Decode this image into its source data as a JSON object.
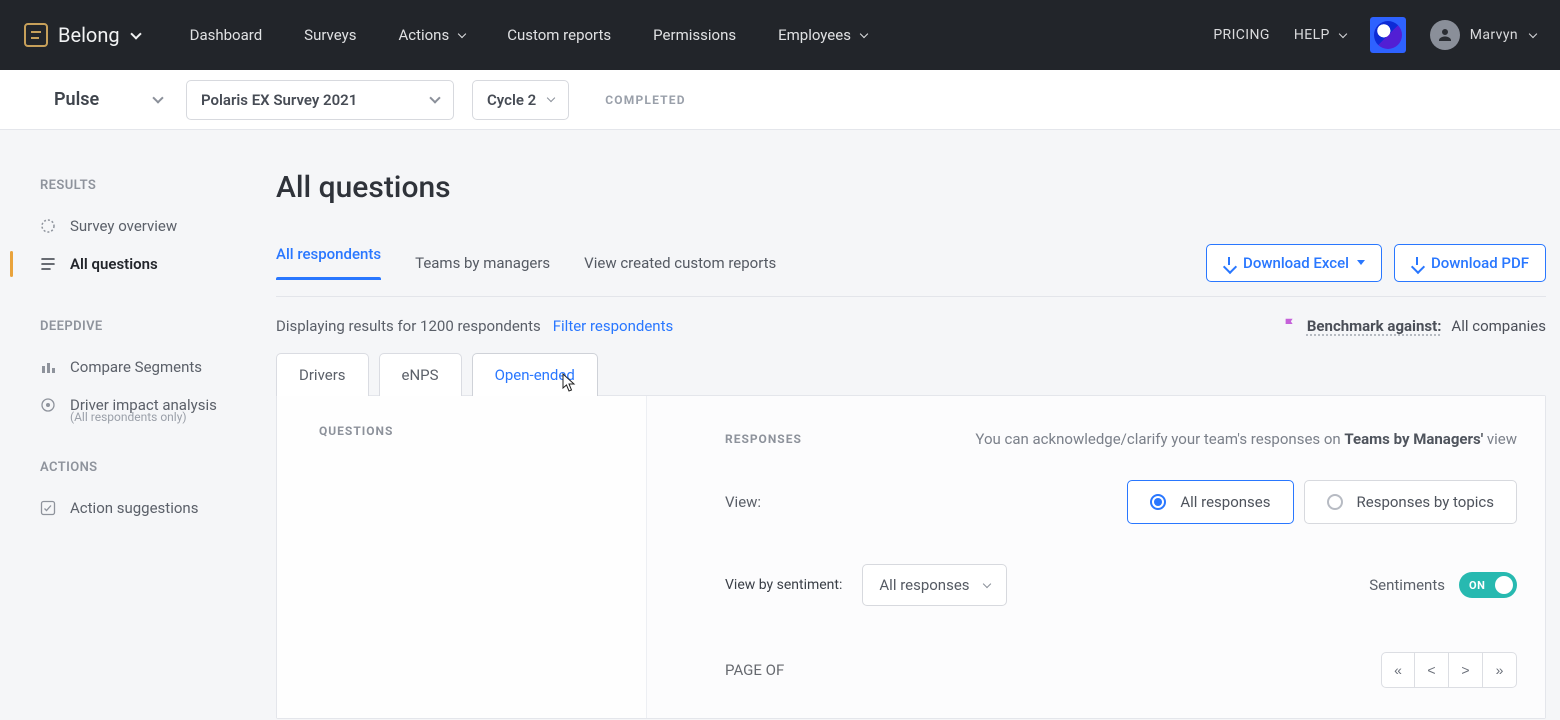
{
  "topnav": {
    "brand": "Belong",
    "links": {
      "dashboard": "Dashboard",
      "surveys": "Surveys",
      "actions": "Actions",
      "custom_reports": "Custom reports",
      "permissions": "Permissions",
      "employees": "Employees"
    },
    "pricing": "PRICING",
    "help": "HELP",
    "user_name": "Marvyn"
  },
  "subheader": {
    "program": "Pulse",
    "survey": "Polaris EX Survey 2021",
    "cycle": "Cycle 2",
    "status": "COMPLETED"
  },
  "sidebar": {
    "results_heading": "RESULTS",
    "survey_overview": "Survey overview",
    "all_questions": "All questions",
    "deepdive_heading": "DEEPDIVE",
    "compare_segments": "Compare Segments",
    "driver_impact": "Driver impact analysis",
    "driver_impact_sub": "(All respondents only)",
    "actions_heading": "ACTIONS",
    "action_suggestions": "Action suggestions"
  },
  "page": {
    "title": "All questions",
    "view_tabs": {
      "all_respondents": "All respondents",
      "teams_by_managers": "Teams by managers",
      "view_custom_reports": "View created custom reports"
    },
    "download_excel": "Download Excel",
    "download_pdf": "Download PDF",
    "results_text_prefix": "Displaying results for ",
    "respondent_count": "1200",
    "results_text_suffix": " respondents",
    "filter_respondents": "Filter respondents",
    "benchmark_label": "Benchmark against:",
    "benchmark_value": "All companies",
    "content_tabs": {
      "drivers": "Drivers",
      "enps": "eNPS",
      "open_ended": "Open-ended"
    },
    "questions_heading": "QUESTIONS",
    "responses_heading": "RESPONSES",
    "ack_prefix": "You can acknowledge/clarify your team's responses on ",
    "ack_bold": "Teams by Managers'",
    "ack_suffix": " view",
    "view_label": "View:",
    "view_all_responses": "All responses",
    "view_by_topics": "Responses by topics",
    "view_by_sentiment_label": "View by sentiment:",
    "sentiment_select": "All responses",
    "sentiments_label": "Sentiments",
    "toggle_state": "ON",
    "page_label": "PAGE OF",
    "pager": {
      "first": "«",
      "prev": "<",
      "next": ">",
      "last": "»"
    }
  }
}
